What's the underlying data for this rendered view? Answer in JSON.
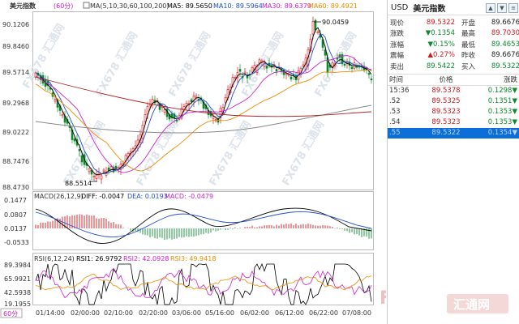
{
  "top_bar": {
    "name": "美元指数",
    "period": "(60分)",
    "ma_label": "MA(5,10,30,60,100,200)",
    "ma5": "MA5: 89.5650",
    "ma10": "MA10: 89.5964",
    "ma30": "MA30: 89.6379",
    "ma60": "MA60: 89.4921"
  },
  "main_axis": {
    "ticks": [
      "90.1206",
      "89.8460",
      "89.5714",
      "89.2968",
      "89.0222",
      "88.7476",
      "88.4730"
    ],
    "high_label": "90.0459",
    "low_label": "88.5514"
  },
  "macd": {
    "label": "MACD(26,12,9)",
    "diff": "DIFF: -0.0047",
    "dea": "DEA: 0.0193",
    "macd": "MACD: -0.0479",
    "ticks": [
      "0.1477",
      "0.0807",
      "0.0137",
      "-0.0533"
    ]
  },
  "rsi": {
    "label": "RSI(6,12,24)",
    "rsi1": "RSI1: 26.9792",
    "rsi2": "RSI2: 42.0928",
    "rsi3": "RSI3: 49.9418",
    "ticks": [
      "89.3984",
      "65.9921",
      "42.5938",
      "19.1955"
    ]
  },
  "x_axis": {
    "ticks": [
      "01/14:00",
      "02/00:00",
      "02/10:00",
      "02/20:00",
      "03/06:00",
      "05/16:00",
      "06/02:00",
      "06/12:00",
      "06/22:00",
      "07/08:00"
    ]
  },
  "period_button": "60分",
  "watermark": {
    "fx": "FX678",
    "cn": "汇通网",
    "domain": "FX678 汇通网"
  },
  "colors": {
    "up": "#d4161b",
    "down": "#0a8a2c",
    "ma5": "#000000",
    "ma10": "#1e4fd8",
    "ma30": "#d21fd2",
    "ma60": "#f08c00",
    "ma100": "#888888",
    "ma200": "#b22222"
  },
  "panel": {
    "code": "USD",
    "title": "美元指数",
    "quotes": [
      {
        "l1": "现价",
        "v1": "89.5322",
        "c1": "up",
        "l2": "开盘",
        "v2": "89.6676",
        "c2": "neutral"
      },
      {
        "l1": "涨跌",
        "v1": "▼0.1354",
        "c1": "down",
        "l2": "最高",
        "v2": "89.7030",
        "c2": "up"
      },
      {
        "l1": "涨幅",
        "v1": "▼0.15%",
        "c1": "down",
        "l2": "最低",
        "v2": "89.4653",
        "c2": "down"
      },
      {
        "l1": "震幅",
        "v1": "▲0.27%",
        "c1": "up",
        "l2": "昨收",
        "v2": "89.6676",
        "c2": "neutral"
      },
      {
        "l1": "卖出",
        "v1": "89.5422",
        "c1": "down",
        "l2": "买入",
        "v2": "89.5322",
        "c2": "down"
      }
    ],
    "tick_header": {
      "time": "时间",
      "price": "价格",
      "change": "涨跌"
    },
    "ticks": [
      {
        "time": "15:36",
        "price": "89.5378",
        "change": "0.1298▼"
      },
      {
        "time": ".52",
        "price": "89.5325",
        "change": "0.1351▼"
      },
      {
        "time": ".53",
        "price": "89.5323",
        "change": "0.1353▼"
      },
      {
        "time": ".54",
        "price": "89.5323",
        "change": "0.1353▼"
      },
      {
        "time": ".55",
        "price": "89.5322",
        "change": "0.1354▼"
      }
    ]
  }
}
